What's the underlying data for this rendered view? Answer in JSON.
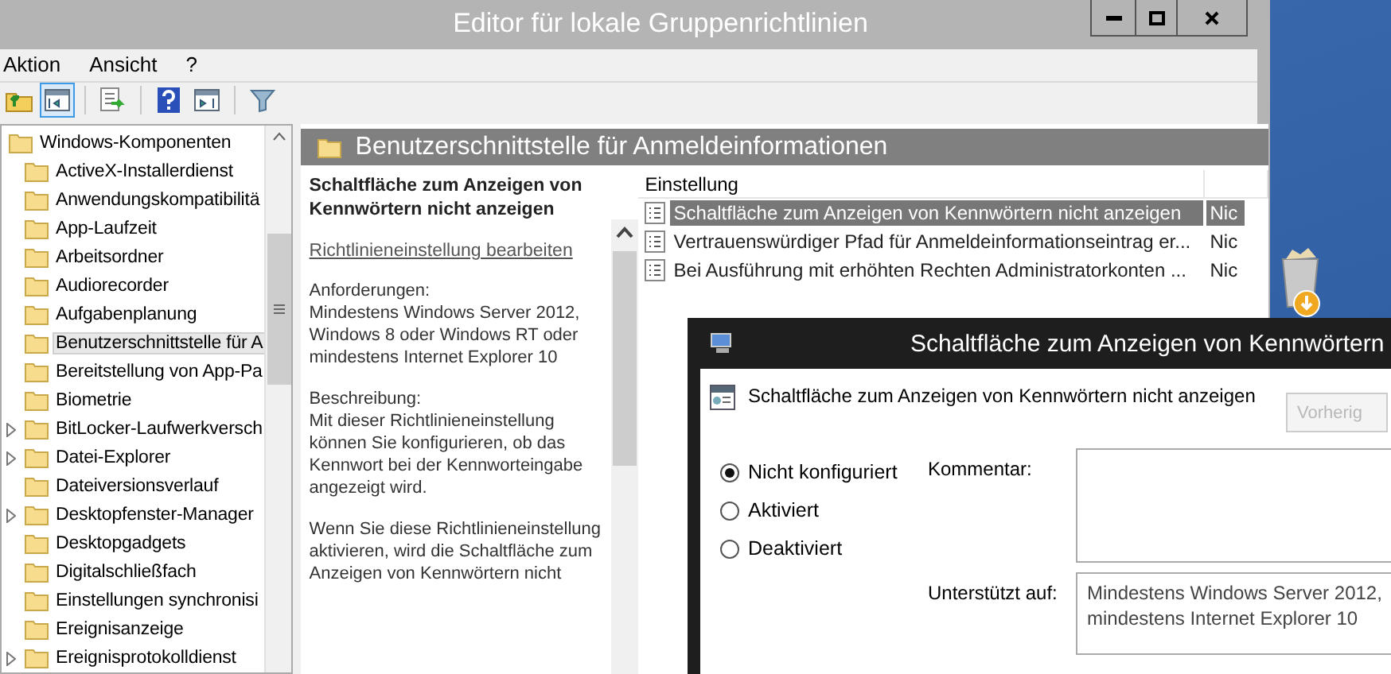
{
  "window": {
    "title": "Editor für lokale Gruppenrichtlinien"
  },
  "menu": [
    "Aktion",
    "Ansicht",
    "?"
  ],
  "toolbar": [
    {
      "kind": "up",
      "pressed": false
    },
    {
      "kind": "tree",
      "pressed": true
    },
    {
      "kind": "export",
      "pressed": false
    },
    {
      "kind": "help",
      "pressed": false
    },
    {
      "kind": "pane",
      "pressed": false
    },
    {
      "kind": "filter",
      "pressed": false
    }
  ],
  "tree": {
    "label": "Windows-Komponenten",
    "expanded": true,
    "children": [
      {
        "label": "ActiveX-Installerdienst",
        "selected": false,
        "expandable": false
      },
      {
        "label": "Anwendungskompatibilitä",
        "selected": false,
        "expandable": false
      },
      {
        "label": "App-Laufzeit",
        "selected": false,
        "expandable": false
      },
      {
        "label": "Arbeitsordner",
        "selected": false,
        "expandable": false
      },
      {
        "label": "Audiorecorder",
        "selected": false,
        "expandable": false
      },
      {
        "label": "Aufgabenplanung",
        "selected": false,
        "expandable": false
      },
      {
        "label": "Benutzerschnittstelle für A",
        "selected": true,
        "expandable": false
      },
      {
        "label": "Bereitstellung von App-Pa",
        "selected": false,
        "expandable": false
      },
      {
        "label": "Biometrie",
        "selected": false,
        "expandable": false
      },
      {
        "label": "BitLocker-Laufwerkversch",
        "selected": false,
        "expandable": true
      },
      {
        "label": "Datei-Explorer",
        "selected": false,
        "expandable": true
      },
      {
        "label": "Dateiversionsverlauf",
        "selected": false,
        "expandable": false
      },
      {
        "label": "Desktopfenster-Manager",
        "selected": false,
        "expandable": true
      },
      {
        "label": "Desktopgadgets",
        "selected": false,
        "expandable": false
      },
      {
        "label": "Digitalschließfach",
        "selected": false,
        "expandable": false
      },
      {
        "label": "Einstellungen synchronisi",
        "selected": false,
        "expandable": false
      },
      {
        "label": "Ereignisanzeige",
        "selected": false,
        "expandable": false
      },
      {
        "label": "Ereignisprotokolldienst",
        "selected": false,
        "expandable": true
      }
    ]
  },
  "details_header": {
    "title": "Benutzerschnittstelle für Anmeldeinformationen"
  },
  "description": {
    "title": "Schaltfläche zum Anzeigen von Kennwörtern nicht anzeigen",
    "link": "Richtlinieneinstellung bearbeiten",
    "paragraphs": [
      "Anforderungen:\nMindestens Windows Server 2012, Windows 8 oder Windows RT oder mindestens Internet Explorer 10",
      "Beschreibung:\nMit dieser Richtlinieneinstellung können Sie konfigurieren, ob das Kennwort bei der Kennworteingabe angezeigt wird.",
      "Wenn Sie diese Richtlinieneinstellung aktivieren, wird die Schaltfläche zum Anzeigen von Kennwörtern nicht"
    ]
  },
  "settings": {
    "columns": [
      "Einstellung"
    ],
    "rows": [
      {
        "name": "Schaltfläche zum Anzeigen von Kennwörtern nicht anzeigen",
        "state": "Nic",
        "selected": true
      },
      {
        "name": "Vertrauenswürdiger Pfad für Anmeldeinformationseintrag er...",
        "state": "Nic",
        "selected": false
      },
      {
        "name": "Bei Ausführung mit erhöhten Rechten Administratorkonten ...",
        "state": "Nic",
        "selected": false
      }
    ]
  },
  "dialog": {
    "title": "Schaltfläche zum Anzeigen von Kennwörtern",
    "policy_name": "Schaltfläche zum Anzeigen von Kennwörtern nicht anzeigen",
    "prev_button": {
      "label": "Vorherig",
      "disabled": true
    },
    "options": [
      {
        "label": "Nicht konfiguriert",
        "selected": true
      },
      {
        "label": "Aktiviert",
        "selected": false
      },
      {
        "label": "Deaktiviert",
        "selected": false
      }
    ],
    "comment_label": "Kommentar:",
    "supported_label": "Unterstützt auf:",
    "supported_lines": [
      "Mindestens Windows Server 2012,",
      "mindestens Internet Explorer 10"
    ]
  }
}
